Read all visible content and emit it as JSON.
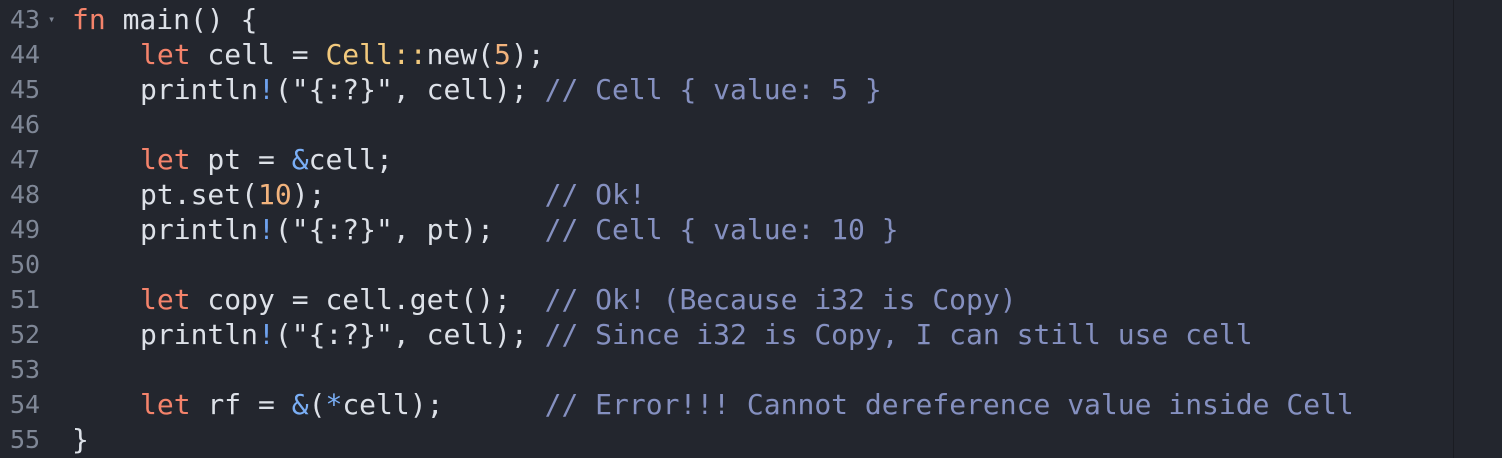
{
  "editor": {
    "line_numbers": [
      "43",
      "44",
      "45",
      "46",
      "47",
      "48",
      "49",
      "50",
      "51",
      "52",
      "53",
      "54",
      "55"
    ],
    "fold_marker": "▾",
    "lines": [
      {
        "tokens": [
          {
            "t": "fn",
            "c": "kw"
          },
          {
            "t": " main() {",
            "c": "plain"
          }
        ]
      },
      {
        "indent": true,
        "tokens": [
          {
            "t": "let",
            "c": "kw"
          },
          {
            "t": " cell = ",
            "c": "plain"
          },
          {
            "t": "Cell::",
            "c": "ty"
          },
          {
            "t": "new(",
            "c": "plain"
          },
          {
            "t": "5",
            "c": "num"
          },
          {
            "t": ");",
            "c": "plain"
          }
        ]
      },
      {
        "indent": true,
        "tokens": [
          {
            "t": "println",
            "c": "plain"
          },
          {
            "t": "!",
            "c": "mac"
          },
          {
            "t": "(\"{:?}\", cell); ",
            "c": "plain"
          },
          {
            "t": "// Cell { value: 5 }",
            "c": "cm"
          }
        ]
      },
      {
        "tokens": []
      },
      {
        "indent": true,
        "tokens": [
          {
            "t": "let",
            "c": "kw"
          },
          {
            "t": " pt = ",
            "c": "plain"
          },
          {
            "t": "&",
            "c": "op"
          },
          {
            "t": "cell;",
            "c": "plain"
          }
        ]
      },
      {
        "indent": true,
        "tokens": [
          {
            "t": "pt.set(",
            "c": "plain"
          },
          {
            "t": "10",
            "c": "num"
          },
          {
            "t": ");             ",
            "c": "plain"
          },
          {
            "t": "// Ok!",
            "c": "cm"
          }
        ]
      },
      {
        "indent": true,
        "tokens": [
          {
            "t": "println",
            "c": "plain"
          },
          {
            "t": "!",
            "c": "mac"
          },
          {
            "t": "(\"{:?}\", pt);   ",
            "c": "plain"
          },
          {
            "t": "// Cell { value: 10 }",
            "c": "cm"
          }
        ]
      },
      {
        "tokens": []
      },
      {
        "indent": true,
        "tokens": [
          {
            "t": "let",
            "c": "kw"
          },
          {
            "t": " copy = cell.get();  ",
            "c": "plain"
          },
          {
            "t": "// Ok! (Because i32 is Copy)",
            "c": "cm"
          }
        ]
      },
      {
        "indent": true,
        "tokens": [
          {
            "t": "println",
            "c": "plain"
          },
          {
            "t": "!",
            "c": "mac"
          },
          {
            "t": "(\"{:?}\", cell); ",
            "c": "plain"
          },
          {
            "t": "// Since i32 is Copy, I can still use cell",
            "c": "cm"
          }
        ]
      },
      {
        "tokens": []
      },
      {
        "indent": true,
        "tokens": [
          {
            "t": "let",
            "c": "kw"
          },
          {
            "t": " rf = ",
            "c": "plain"
          },
          {
            "t": "&",
            "c": "op"
          },
          {
            "t": "(",
            "c": "plain"
          },
          {
            "t": "*",
            "c": "op"
          },
          {
            "t": "cell);      ",
            "c": "plain"
          },
          {
            "t": "// Error!!! Cannot dereference value inside Cell",
            "c": "cm"
          }
        ]
      },
      {
        "tokens": [
          {
            "t": "}",
            "c": "plain"
          }
        ]
      }
    ]
  }
}
